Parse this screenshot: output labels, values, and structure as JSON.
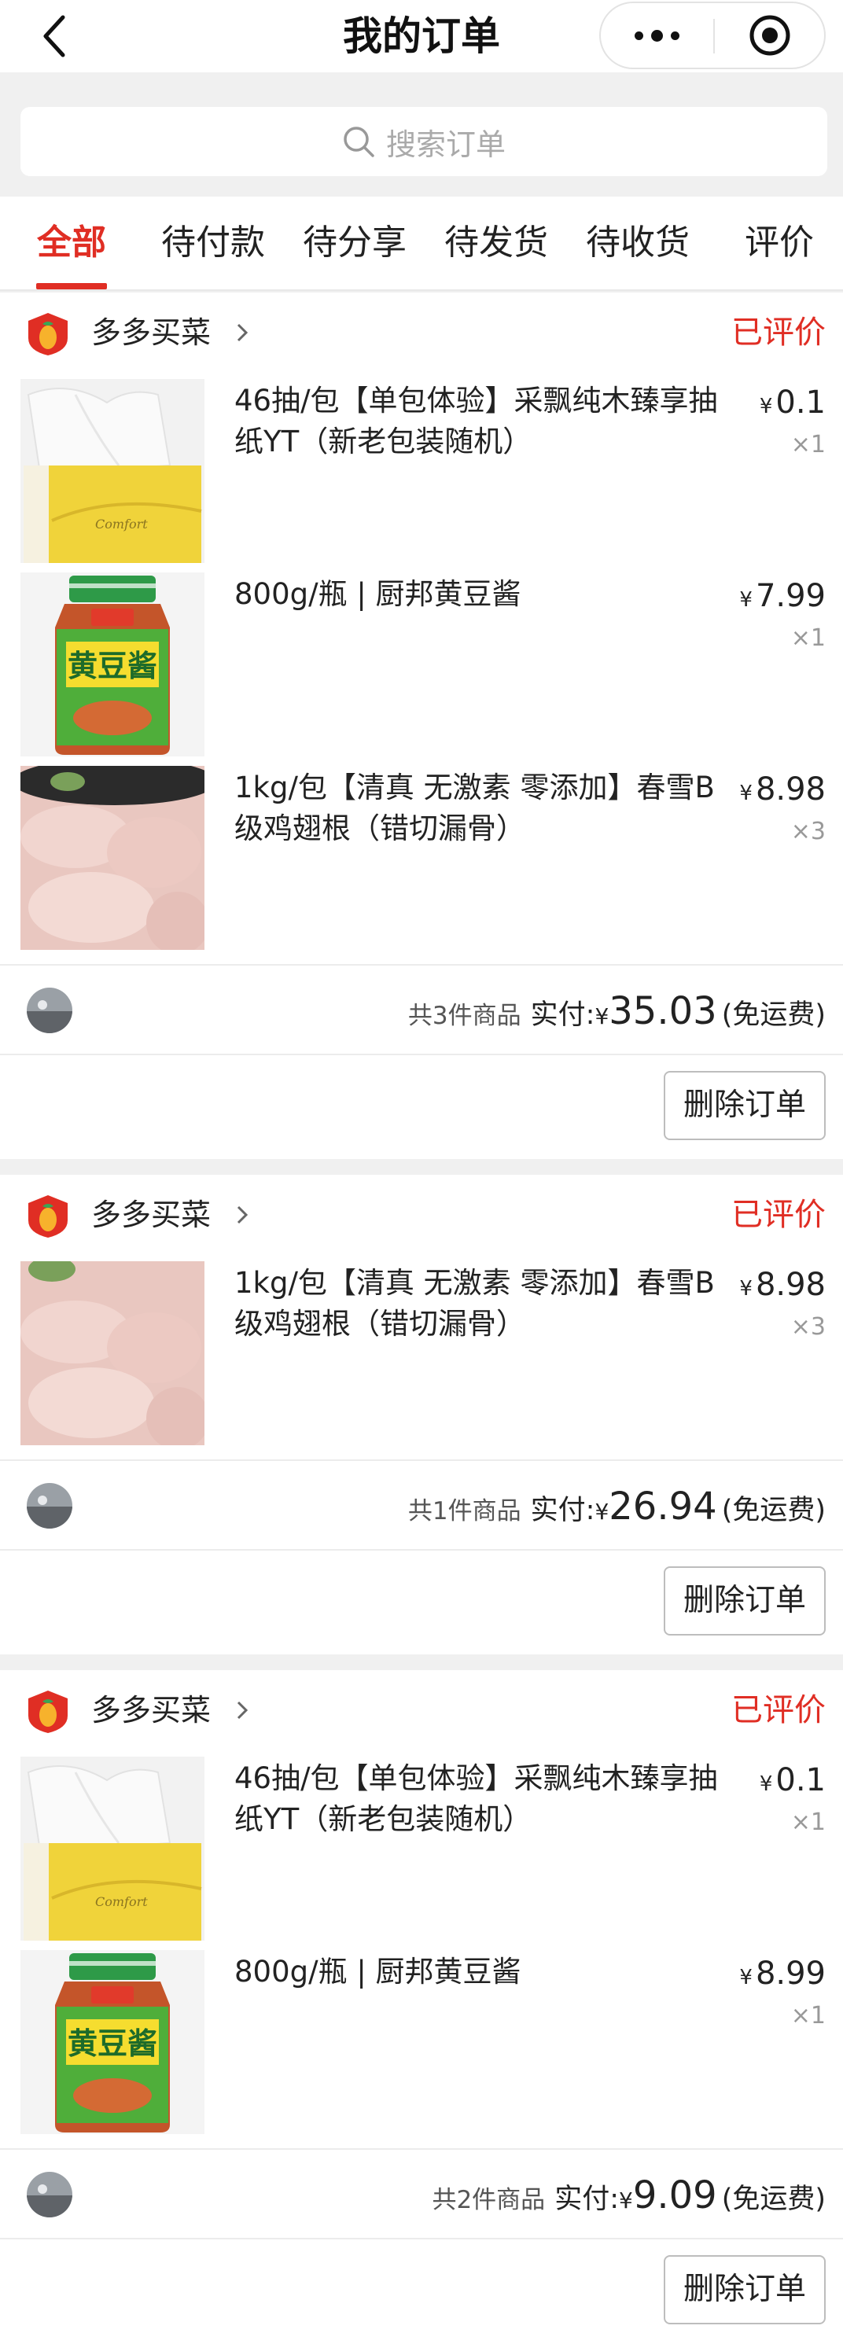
{
  "nav": {
    "title": "我的订单"
  },
  "search": {
    "placeholder": "搜索订单"
  },
  "tabs": [
    {
      "label": "全部",
      "active": true
    },
    {
      "label": "待付款",
      "active": false
    },
    {
      "label": "待分享",
      "active": false
    },
    {
      "label": "待发货",
      "active": false
    },
    {
      "label": "待收货",
      "active": false
    },
    {
      "label": "评价",
      "active": false
    }
  ],
  "orders": [
    {
      "shop": "多多买菜",
      "status": "已评价",
      "items": [
        {
          "title": "46抽/包【单包体验】采飘纯木臻享抽纸YT（新老包装随机）",
          "currency": "¥",
          "price": "0.1",
          "qty": "×1",
          "image": "tissue"
        },
        {
          "title": "800g/瓶 | 厨邦黄豆酱",
          "currency": "¥",
          "price": "7.99",
          "qty": "×1",
          "image": "soy-paste"
        },
        {
          "title": "1kg/包【清真 无激素 零添加】春雪B级鸡翅根（错切漏骨）",
          "currency": "¥",
          "price": "8.98",
          "qty": "×3",
          "image": "chicken"
        }
      ],
      "count_text": "共3件商品",
      "paid_label": "实付:",
      "currency": "¥",
      "amount": "35.03",
      "shipping": "(免运费)",
      "delete_label": "删除订单"
    },
    {
      "shop": "多多买菜",
      "status": "已评价",
      "items": [
        {
          "title": "1kg/包【清真 无激素 零添加】春雪B级鸡翅根（错切漏骨）",
          "currency": "¥",
          "price": "8.98",
          "qty": "×3",
          "image": "chicken"
        }
      ],
      "count_text": "共1件商品",
      "paid_label": "实付:",
      "currency": "¥",
      "amount": "26.94",
      "shipping": "(免运费)",
      "delete_label": "删除订单"
    },
    {
      "shop": "多多买菜",
      "status": "已评价",
      "items": [
        {
          "title": "46抽/包【单包体验】采飘纯木臻享抽纸YT（新老包装随机）",
          "currency": "¥",
          "price": "0.1",
          "qty": "×1",
          "image": "tissue"
        },
        {
          "title": "800g/瓶 | 厨邦黄豆酱",
          "currency": "¥",
          "price": "8.99",
          "qty": "×1",
          "image": "soy-paste"
        }
      ],
      "count_text": "共2件商品",
      "paid_label": "实付:",
      "currency": "¥",
      "amount": "9.09",
      "shipping": "(免运费)",
      "delete_label": "删除订单"
    }
  ],
  "colors": {
    "accent": "#e02e24",
    "text": "#222222",
    "muted": "#999999",
    "background": "#f0f0f0"
  },
  "icons": [
    "back-arrow-icon",
    "more-dots-icon",
    "close-target-icon",
    "search-icon",
    "shop-logo-icon",
    "chevron-right-icon"
  ]
}
